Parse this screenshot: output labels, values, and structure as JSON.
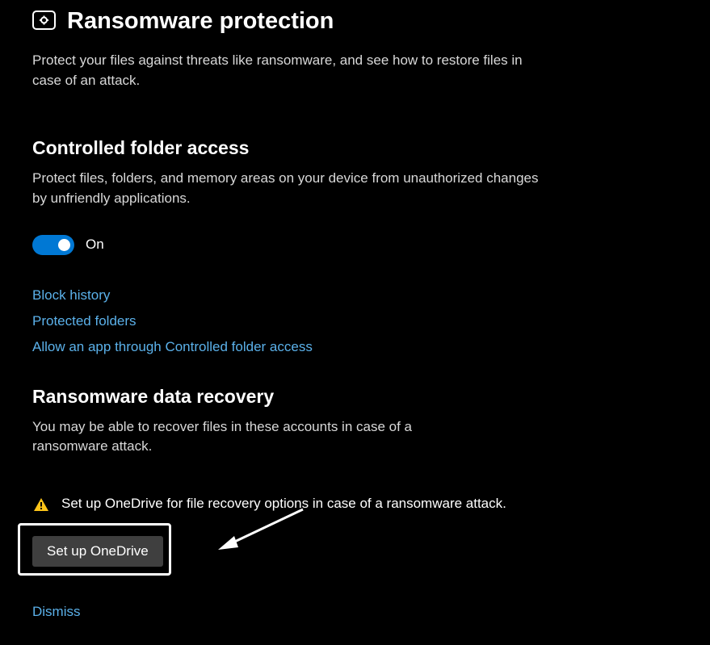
{
  "page": {
    "title": "Ransomware protection",
    "description": "Protect your files against threats like ransomware, and see how to restore files in case of an attack."
  },
  "controlledFolderAccess": {
    "title": "Controlled folder access",
    "description": "Protect files, folders, and memory areas on your device from unauthorized changes by unfriendly applications.",
    "toggle": {
      "state": true,
      "label": "On"
    },
    "links": [
      "Block history",
      "Protected folders",
      "Allow an app through Controlled folder access"
    ]
  },
  "dataRecovery": {
    "title": "Ransomware data recovery",
    "description": "You may be able to recover files in these accounts in case of a ransomware attack.",
    "warning": "Set up OneDrive for file recovery options in case of a ransomware attack.",
    "buttonLabel": "Set up OneDrive",
    "dismissLabel": "Dismiss"
  },
  "colors": {
    "accent": "#0078d4",
    "link": "#5bb1ea",
    "buttonBg": "#3f3f3f"
  }
}
